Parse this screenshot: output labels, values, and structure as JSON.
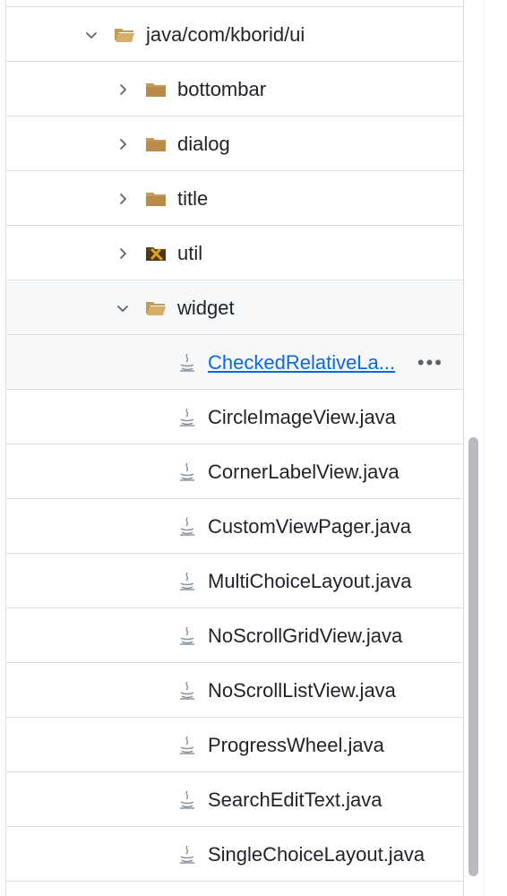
{
  "tree": {
    "parent": {
      "label": "java/com/kborid/ui",
      "expanded": true
    },
    "folders": [
      {
        "label": "bottombar",
        "expanded": false
      },
      {
        "label": "dialog",
        "expanded": false
      },
      {
        "label": "title",
        "expanded": false
      },
      {
        "label": "util",
        "expanded": false
      },
      {
        "label": "widget",
        "expanded": true
      }
    ],
    "files": [
      {
        "label": "CheckedRelativeLa...",
        "selected": true
      },
      {
        "label": "CircleImageView.java"
      },
      {
        "label": "CornerLabelView.java"
      },
      {
        "label": "CustomViewPager.java"
      },
      {
        "label": "MultiChoiceLayout.java"
      },
      {
        "label": "NoScrollGridView.java"
      },
      {
        "label": "NoScrollListView.java"
      },
      {
        "label": "ProgressWheel.java"
      },
      {
        "label": "SearchEditText.java"
      },
      {
        "label": "SingleChoiceLayout.java"
      }
    ],
    "more_label": "•••"
  },
  "colors": {
    "folder": "#c69a58",
    "link": "#0969da",
    "border": "#d8dee4",
    "selected_bg": "#f6f8fa"
  }
}
